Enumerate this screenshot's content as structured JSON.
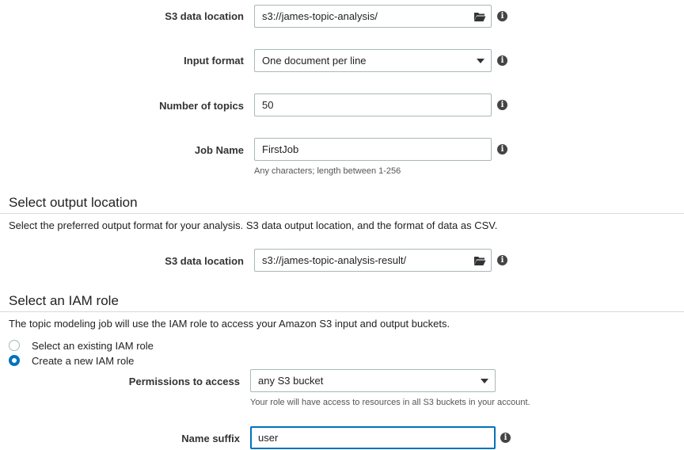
{
  "input": {
    "s3_location_label": "S3 data location",
    "s3_location_value": "s3://james-topic-analysis/",
    "input_format_label": "Input format",
    "input_format_value": "One document per line",
    "num_topics_label": "Number of topics",
    "num_topics_value": "50",
    "job_name_label": "Job Name",
    "job_name_value": "FirstJob",
    "job_name_hint": "Any characters; length between 1-256"
  },
  "output": {
    "title": "Select output location",
    "description": "Select the preferred output format for your analysis. S3 data output location, and the format of data as CSV.",
    "s3_location_label": "S3 data location",
    "s3_location_value": "s3://james-topic-analysis-result/"
  },
  "iam": {
    "title": "Select an IAM role",
    "description": "The topic modeling job will use the IAM role to access your Amazon S3 input and output buckets.",
    "option_existing": "Select an existing IAM role",
    "option_new": "Create a new IAM role",
    "permissions_label": "Permissions to access",
    "permissions_value": "any S3 bucket",
    "permissions_hint": "Your role will have access to resources in all S3 buckets in your account.",
    "name_suffix_label": "Name suffix",
    "name_suffix_value": "user"
  },
  "icons": {
    "folder": "folder-open-icon",
    "info": "info-icon",
    "dropdown": "chevron-down-icon"
  },
  "colors": {
    "accent": "#0073bb",
    "border": "#aab7b8",
    "divider": "#d5dbdb"
  }
}
